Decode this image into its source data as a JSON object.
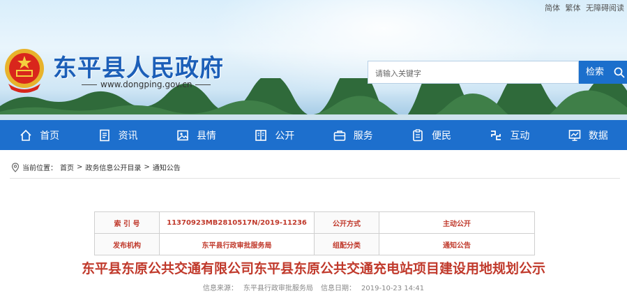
{
  "top_links": [
    "简体",
    "繁体",
    "无障碍阅读"
  ],
  "site": {
    "title": "东平县人民政府",
    "url": "www.dongping.gov.cn"
  },
  "search": {
    "placeholder": "请输入关键字",
    "button_label": "检索"
  },
  "nav": [
    {
      "label": "首页",
      "icon": "home-icon"
    },
    {
      "label": "资讯",
      "icon": "news-icon"
    },
    {
      "label": "县情",
      "icon": "image-icon"
    },
    {
      "label": "公开",
      "icon": "book-icon"
    },
    {
      "label": "服务",
      "icon": "briefcase-icon"
    },
    {
      "label": "便民",
      "icon": "clipboard-icon"
    },
    {
      "label": "互动",
      "icon": "interact-icon"
    },
    {
      "label": "数据",
      "icon": "chart-icon"
    }
  ],
  "breadcrumb": {
    "prefix": "当前位置：",
    "items": [
      "首页",
      "政务信息公开目录",
      "通知公告"
    ],
    "separator": ">"
  },
  "info": {
    "index_label": "索 引 号",
    "index_value": "11370923MB2810517N/2019-11236",
    "method_label": "公开方式",
    "method_value": "主动公开",
    "publisher_label": "发布机构",
    "publisher_value": "东平县行政审批服务局",
    "category_label": "组配分类",
    "category_value": "通知公告"
  },
  "article": {
    "title": "东平县东原公共交通有限公司东平县东原公共交通充电站项目建设用地规划公示",
    "source_label": "信息来源：",
    "source_value": "东平县行政审批服务局",
    "date_label": "信息日期：",
    "date_value": "2019-10-23 14:41"
  },
  "colors": {
    "nav_bg": "#1d6fcd",
    "title_blue": "#1c5fb8",
    "accent_red": "#c0392b"
  }
}
